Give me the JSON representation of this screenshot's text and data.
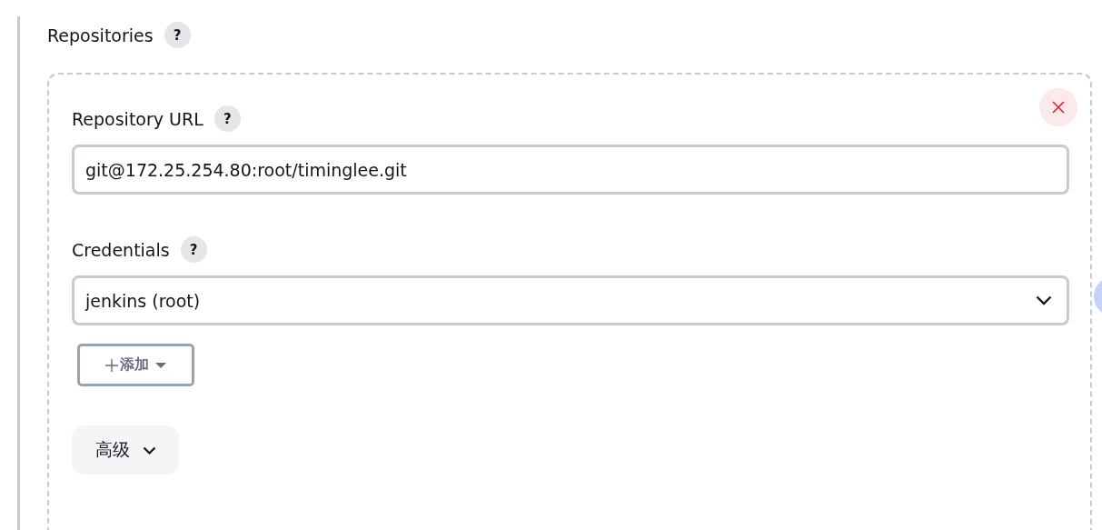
{
  "section": {
    "label": "Repositories",
    "help": "?"
  },
  "repository": {
    "url_field": {
      "label": "Repository URL",
      "help": "?",
      "value": "git@172.25.254.80:root/timinglee.git"
    },
    "credentials": {
      "label": "Credentials",
      "help": "?",
      "value": "jenkins (root)"
    },
    "add_button": {
      "label": "添加"
    },
    "advanced_button": {
      "label": "高级",
      "expanded": false
    }
  }
}
